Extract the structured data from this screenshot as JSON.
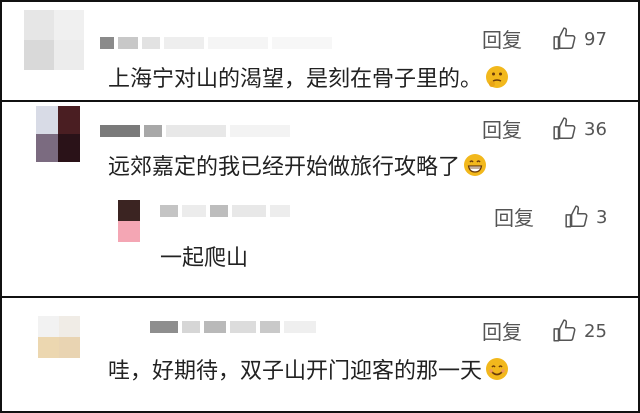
{
  "comments": [
    {
      "text": "上海宁对山的渴望，是刻在骨子里的。",
      "reply_label": "回复",
      "likes": "97",
      "emoji_icon": "thinking-face-icon"
    },
    {
      "text": "远郊嘉定的我已经开始做旅行攻略了",
      "reply_label": "回复",
      "likes": "36",
      "emoji_icon": "grinning-face-icon",
      "replies": [
        {
          "text": "一起爬山",
          "reply_label": "回复",
          "likes": "3"
        }
      ]
    },
    {
      "text": "哇，好期待，双子山开门迎客的那一天",
      "reply_label": "回复",
      "likes": "25",
      "emoji_icon": "smiling-face-icon"
    }
  ],
  "colors": {
    "border": "#111111",
    "text": "#222222",
    "meta": "#555555",
    "emoji": "#f2b81c"
  }
}
